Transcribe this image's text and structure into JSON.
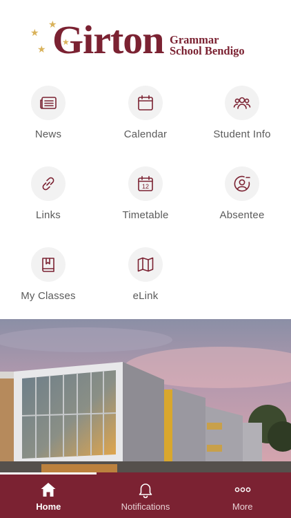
{
  "logo": {
    "name": "Girton",
    "subtitle_line1": "Grammar",
    "subtitle_line2": "School Bendigo"
  },
  "menu": [
    {
      "label": "News",
      "icon": "newspaper-icon"
    },
    {
      "label": "Calendar",
      "icon": "calendar-icon"
    },
    {
      "label": "Student Info",
      "icon": "people-icon"
    },
    {
      "label": "Links",
      "icon": "link-icon"
    },
    {
      "label": "Timetable",
      "icon": "timetable-icon"
    },
    {
      "label": "Absentee",
      "icon": "person-minus-icon"
    },
    {
      "label": "My Classes",
      "icon": "book-icon"
    },
    {
      "label": "eLink",
      "icon": "map-icon"
    }
  ],
  "timetable_icon_day": "12",
  "tabs": [
    {
      "label": "Home",
      "icon": "home-icon",
      "active": true
    },
    {
      "label": "Notifications",
      "icon": "bell-icon",
      "active": false
    },
    {
      "label": "More",
      "icon": "more-dots-icon",
      "active": false
    }
  ],
  "colors": {
    "brand": "#7b2232",
    "star": "#d9b25a",
    "icon_circle": "#f2f2f2"
  }
}
